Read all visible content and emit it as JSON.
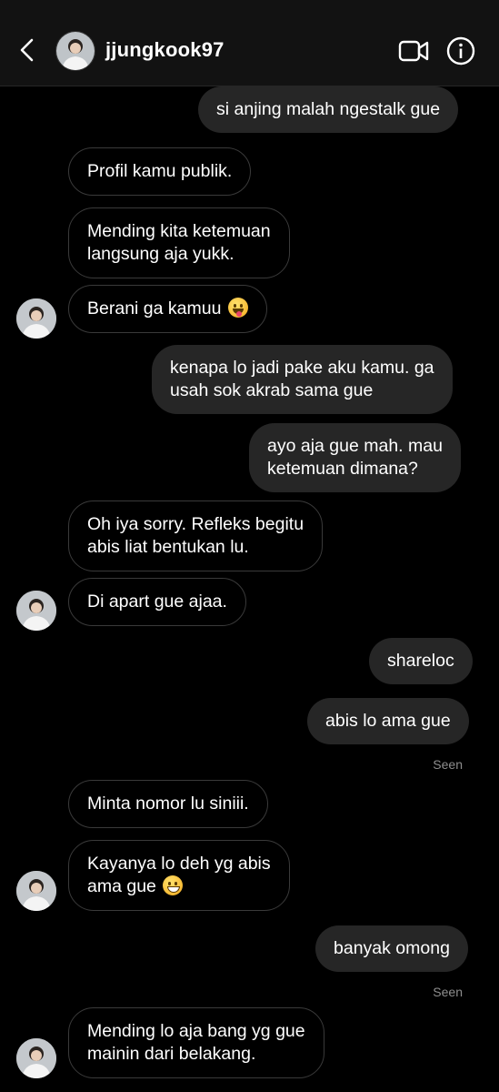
{
  "header": {
    "username": "jjungkook97"
  },
  "messages": {
    "m1": "si anjing malah ngestalk gue",
    "m2": "Profil kamu publik.",
    "m3_l1": "Mending kita ketemuan",
    "m3_l2": "langsung aja yukk.",
    "m4": "Berani ga kamuu",
    "m5_l1": "kenapa lo jadi pake aku kamu. ga",
    "m5_l2": "usah sok akrab sama gue",
    "m6_l1": "ayo aja gue mah. mau",
    "m6_l2": "ketemuan dimana?",
    "m7_l1": "Oh iya sorry. Refleks begitu",
    "m7_l2": "abis liat bentukan lu.",
    "m8": "Di apart gue ajaa.",
    "m9": "shareloc",
    "m10": "abis lo ama gue",
    "seen1": "Seen",
    "m11": "Minta nomor lu siniii.",
    "m12_l1": "Kayanya lo deh yg abis",
    "m12_l2": "ama gue",
    "m13": "banyak omong",
    "seen2": "Seen",
    "m14_l1": "Mending lo aja bang yg gue",
    "m14_l2": "mainin dari belakang."
  },
  "emojis": {
    "m4": "face-savoring-food",
    "m12": "grinning-face"
  },
  "colors": {
    "background": "#000000",
    "outgoing_bubble": "#262626",
    "incoming_border": "#3a3a3a",
    "seen_text": "#8e8e8e"
  }
}
